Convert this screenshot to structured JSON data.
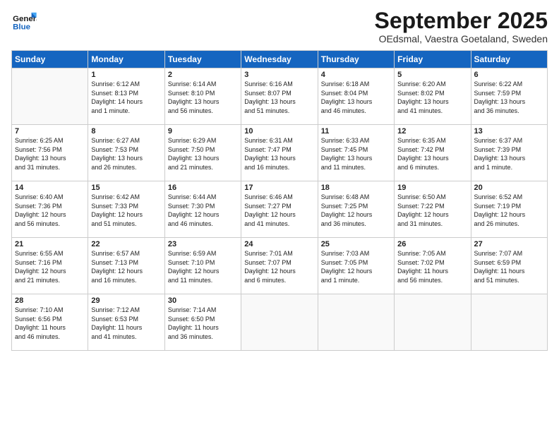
{
  "header": {
    "logo_line1": "General",
    "logo_line2": "Blue",
    "month": "September 2025",
    "location": "OEdsmal, Vaestra Goetaland, Sweden"
  },
  "days_of_week": [
    "Sunday",
    "Monday",
    "Tuesday",
    "Wednesday",
    "Thursday",
    "Friday",
    "Saturday"
  ],
  "weeks": [
    [
      {
        "day": "",
        "info": ""
      },
      {
        "day": "1",
        "info": "Sunrise: 6:12 AM\nSunset: 8:13 PM\nDaylight: 14 hours\nand 1 minute."
      },
      {
        "day": "2",
        "info": "Sunrise: 6:14 AM\nSunset: 8:10 PM\nDaylight: 13 hours\nand 56 minutes."
      },
      {
        "day": "3",
        "info": "Sunrise: 6:16 AM\nSunset: 8:07 PM\nDaylight: 13 hours\nand 51 minutes."
      },
      {
        "day": "4",
        "info": "Sunrise: 6:18 AM\nSunset: 8:04 PM\nDaylight: 13 hours\nand 46 minutes."
      },
      {
        "day": "5",
        "info": "Sunrise: 6:20 AM\nSunset: 8:02 PM\nDaylight: 13 hours\nand 41 minutes."
      },
      {
        "day": "6",
        "info": "Sunrise: 6:22 AM\nSunset: 7:59 PM\nDaylight: 13 hours\nand 36 minutes."
      }
    ],
    [
      {
        "day": "7",
        "info": "Sunrise: 6:25 AM\nSunset: 7:56 PM\nDaylight: 13 hours\nand 31 minutes."
      },
      {
        "day": "8",
        "info": "Sunrise: 6:27 AM\nSunset: 7:53 PM\nDaylight: 13 hours\nand 26 minutes."
      },
      {
        "day": "9",
        "info": "Sunrise: 6:29 AM\nSunset: 7:50 PM\nDaylight: 13 hours\nand 21 minutes."
      },
      {
        "day": "10",
        "info": "Sunrise: 6:31 AM\nSunset: 7:47 PM\nDaylight: 13 hours\nand 16 minutes."
      },
      {
        "day": "11",
        "info": "Sunrise: 6:33 AM\nSunset: 7:45 PM\nDaylight: 13 hours\nand 11 minutes."
      },
      {
        "day": "12",
        "info": "Sunrise: 6:35 AM\nSunset: 7:42 PM\nDaylight: 13 hours\nand 6 minutes."
      },
      {
        "day": "13",
        "info": "Sunrise: 6:37 AM\nSunset: 7:39 PM\nDaylight: 13 hours\nand 1 minute."
      }
    ],
    [
      {
        "day": "14",
        "info": "Sunrise: 6:40 AM\nSunset: 7:36 PM\nDaylight: 12 hours\nand 56 minutes."
      },
      {
        "day": "15",
        "info": "Sunrise: 6:42 AM\nSunset: 7:33 PM\nDaylight: 12 hours\nand 51 minutes."
      },
      {
        "day": "16",
        "info": "Sunrise: 6:44 AM\nSunset: 7:30 PM\nDaylight: 12 hours\nand 46 minutes."
      },
      {
        "day": "17",
        "info": "Sunrise: 6:46 AM\nSunset: 7:27 PM\nDaylight: 12 hours\nand 41 minutes."
      },
      {
        "day": "18",
        "info": "Sunrise: 6:48 AM\nSunset: 7:25 PM\nDaylight: 12 hours\nand 36 minutes."
      },
      {
        "day": "19",
        "info": "Sunrise: 6:50 AM\nSunset: 7:22 PM\nDaylight: 12 hours\nand 31 minutes."
      },
      {
        "day": "20",
        "info": "Sunrise: 6:52 AM\nSunset: 7:19 PM\nDaylight: 12 hours\nand 26 minutes."
      }
    ],
    [
      {
        "day": "21",
        "info": "Sunrise: 6:55 AM\nSunset: 7:16 PM\nDaylight: 12 hours\nand 21 minutes."
      },
      {
        "day": "22",
        "info": "Sunrise: 6:57 AM\nSunset: 7:13 PM\nDaylight: 12 hours\nand 16 minutes."
      },
      {
        "day": "23",
        "info": "Sunrise: 6:59 AM\nSunset: 7:10 PM\nDaylight: 12 hours\nand 11 minutes."
      },
      {
        "day": "24",
        "info": "Sunrise: 7:01 AM\nSunset: 7:07 PM\nDaylight: 12 hours\nand 6 minutes."
      },
      {
        "day": "25",
        "info": "Sunrise: 7:03 AM\nSunset: 7:05 PM\nDaylight: 12 hours\nand 1 minute."
      },
      {
        "day": "26",
        "info": "Sunrise: 7:05 AM\nSunset: 7:02 PM\nDaylight: 11 hours\nand 56 minutes."
      },
      {
        "day": "27",
        "info": "Sunrise: 7:07 AM\nSunset: 6:59 PM\nDaylight: 11 hours\nand 51 minutes."
      }
    ],
    [
      {
        "day": "28",
        "info": "Sunrise: 7:10 AM\nSunset: 6:56 PM\nDaylight: 11 hours\nand 46 minutes."
      },
      {
        "day": "29",
        "info": "Sunrise: 7:12 AM\nSunset: 6:53 PM\nDaylight: 11 hours\nand 41 minutes."
      },
      {
        "day": "30",
        "info": "Sunrise: 7:14 AM\nSunset: 6:50 PM\nDaylight: 11 hours\nand 36 minutes."
      },
      {
        "day": "",
        "info": ""
      },
      {
        "day": "",
        "info": ""
      },
      {
        "day": "",
        "info": ""
      },
      {
        "day": "",
        "info": ""
      }
    ]
  ]
}
